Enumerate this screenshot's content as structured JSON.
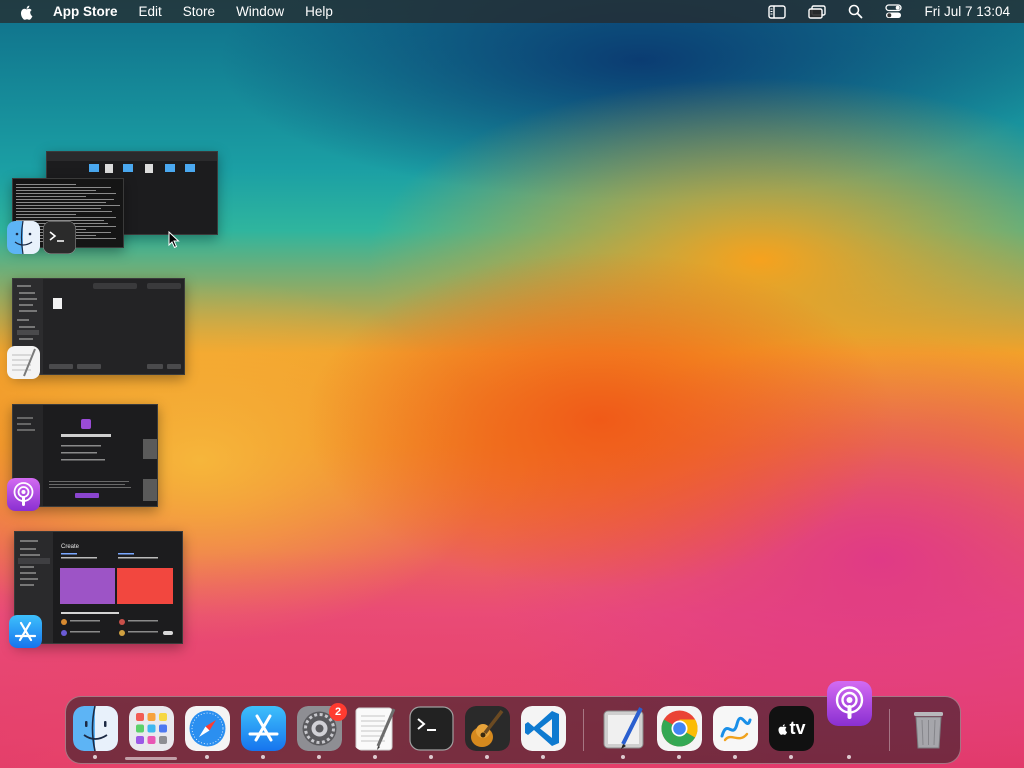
{
  "menubar": {
    "app_name": "App Store",
    "menus": [
      "Edit",
      "Store",
      "Window",
      "Help"
    ],
    "clock": "Fri Jul 7  13:04",
    "status_icons": [
      "sidebar-icon",
      "screen-mirroring-icon",
      "search-icon",
      "control-center-icon"
    ]
  },
  "expose": {
    "groups": [
      {
        "apps": [
          "Finder",
          "Terminal"
        ],
        "icons": [
          "finder-icon",
          "terminal-icon"
        ]
      },
      {
        "apps": [
          "TextEdit"
        ],
        "icons": [
          "textedit-icon"
        ]
      },
      {
        "apps": [
          "Podcasts"
        ],
        "icons": [
          "podcasts-icon"
        ]
      },
      {
        "apps": [
          "App Store"
        ],
        "icons": [
          "app-store-icon"
        ]
      }
    ],
    "app_store_thumb": {
      "heading": "Create"
    }
  },
  "dock": {
    "apps": [
      {
        "name": "Finder",
        "icon": "finder-icon",
        "running": true
      },
      {
        "name": "Launchpad",
        "icon": "launchpad-icon",
        "running": false
      },
      {
        "name": "Safari",
        "icon": "safari-icon",
        "running": true
      },
      {
        "name": "App Store",
        "icon": "app-store-icon",
        "running": true
      },
      {
        "name": "System Settings",
        "icon": "settings-icon",
        "running": true,
        "badge": "2"
      },
      {
        "name": "TextEdit",
        "icon": "textedit-icon",
        "running": true
      },
      {
        "name": "Terminal",
        "icon": "terminal-icon",
        "running": true
      },
      {
        "name": "GarageBand",
        "icon": "garageband-icon",
        "running": true
      },
      {
        "name": "Visual Studio Code",
        "icon": "vscode-icon",
        "running": true
      },
      {
        "name": "Preview",
        "icon": "preview-icon",
        "running": true
      },
      {
        "name": "Google Chrome",
        "icon": "chrome-icon",
        "running": true
      },
      {
        "name": "Freeform",
        "icon": "freeform-icon",
        "running": true
      },
      {
        "name": "Apple TV",
        "icon": "appletv-icon",
        "running": true
      },
      {
        "name": "Podcasts",
        "icon": "podcasts-icon",
        "running": true
      },
      {
        "name": "Trash",
        "icon": "trash-icon",
        "running": false
      }
    ],
    "appletv_label": "tv"
  }
}
